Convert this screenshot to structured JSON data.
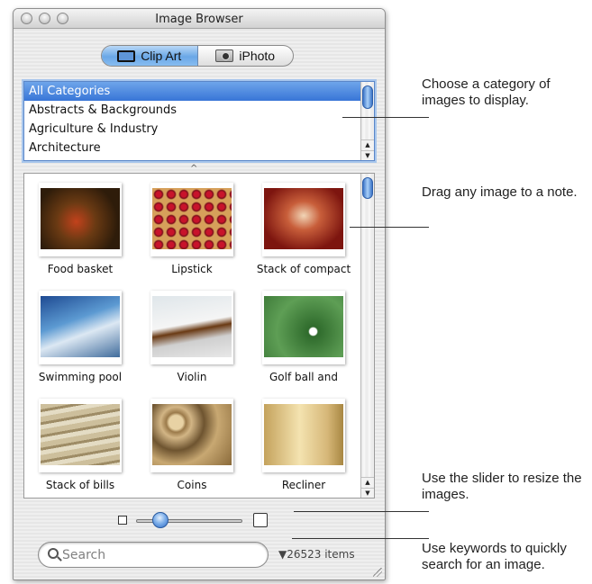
{
  "window": {
    "title": "Image Browser"
  },
  "source_tabs": [
    {
      "label": "Clip Art",
      "icon": "clipart-icon",
      "selected": true
    },
    {
      "label": "iPhoto",
      "icon": "camera-icon",
      "selected": false
    }
  ],
  "categories": [
    {
      "label": "All Categories",
      "selected": true
    },
    {
      "label": "Abstracts & Backgrounds",
      "selected": false
    },
    {
      "label": "Agriculture & Industry",
      "selected": false
    },
    {
      "label": "Architecture",
      "selected": false
    }
  ],
  "images": [
    {
      "caption": "Food basket"
    },
    {
      "caption": "Lipstick"
    },
    {
      "caption": "Stack of compact"
    },
    {
      "caption": "Swimming pool"
    },
    {
      "caption": "Violin"
    },
    {
      "caption": "Golf ball and"
    },
    {
      "caption": "Stack of bills"
    },
    {
      "caption": "Coins"
    },
    {
      "caption": "Recliner"
    }
  ],
  "search": {
    "placeholder": "Search",
    "value": ""
  },
  "item_count": "▼26523 items",
  "callouts": {
    "category": "Choose a category of images to display.",
    "drag": "Drag any image to a note.",
    "slider": "Use the slider to resize the images.",
    "search": "Use keywords to quickly search for an image."
  },
  "colors": {
    "selection": "#3875d7",
    "accent": "#6aa7e6"
  }
}
